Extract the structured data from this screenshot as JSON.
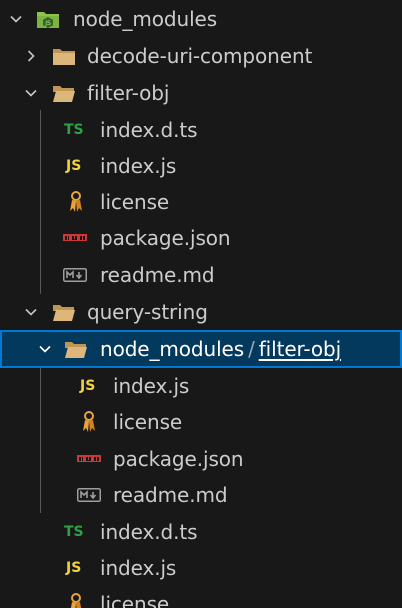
{
  "explorer": {
    "root": {
      "label": "node_modules",
      "icon": "node-modules-folder-icon"
    },
    "items": [
      {
        "label": "decode-uri-component",
        "icon": "folder-closed-icon"
      },
      {
        "label": "filter-obj",
        "icon": "folder-open-icon"
      },
      {
        "label": "index.d.ts",
        "icon": "typescript-icon",
        "badge": "TS"
      },
      {
        "label": "index.js",
        "icon": "javascript-icon",
        "badge": "JS"
      },
      {
        "label": "license",
        "icon": "license-icon"
      },
      {
        "label": "package.json",
        "icon": "npm-icon"
      },
      {
        "label": "readme.md",
        "icon": "markdown-icon"
      },
      {
        "label": "query-string",
        "icon": "folder-open-icon"
      },
      {
        "label_a": "node_modules",
        "separator": "/",
        "label_b": "filter-obj",
        "icon": "folder-open-icon",
        "selected": true
      },
      {
        "label": "index.js",
        "icon": "javascript-icon",
        "badge": "JS"
      },
      {
        "label": "license",
        "icon": "license-icon"
      },
      {
        "label": "package.json",
        "icon": "npm-icon"
      },
      {
        "label": "readme.md",
        "icon": "markdown-icon"
      },
      {
        "label": "index.d.ts",
        "icon": "typescript-icon",
        "badge": "TS"
      },
      {
        "label": "index.js",
        "icon": "javascript-icon",
        "badge": "JS"
      },
      {
        "label": "license",
        "icon": "license-icon"
      }
    ]
  }
}
